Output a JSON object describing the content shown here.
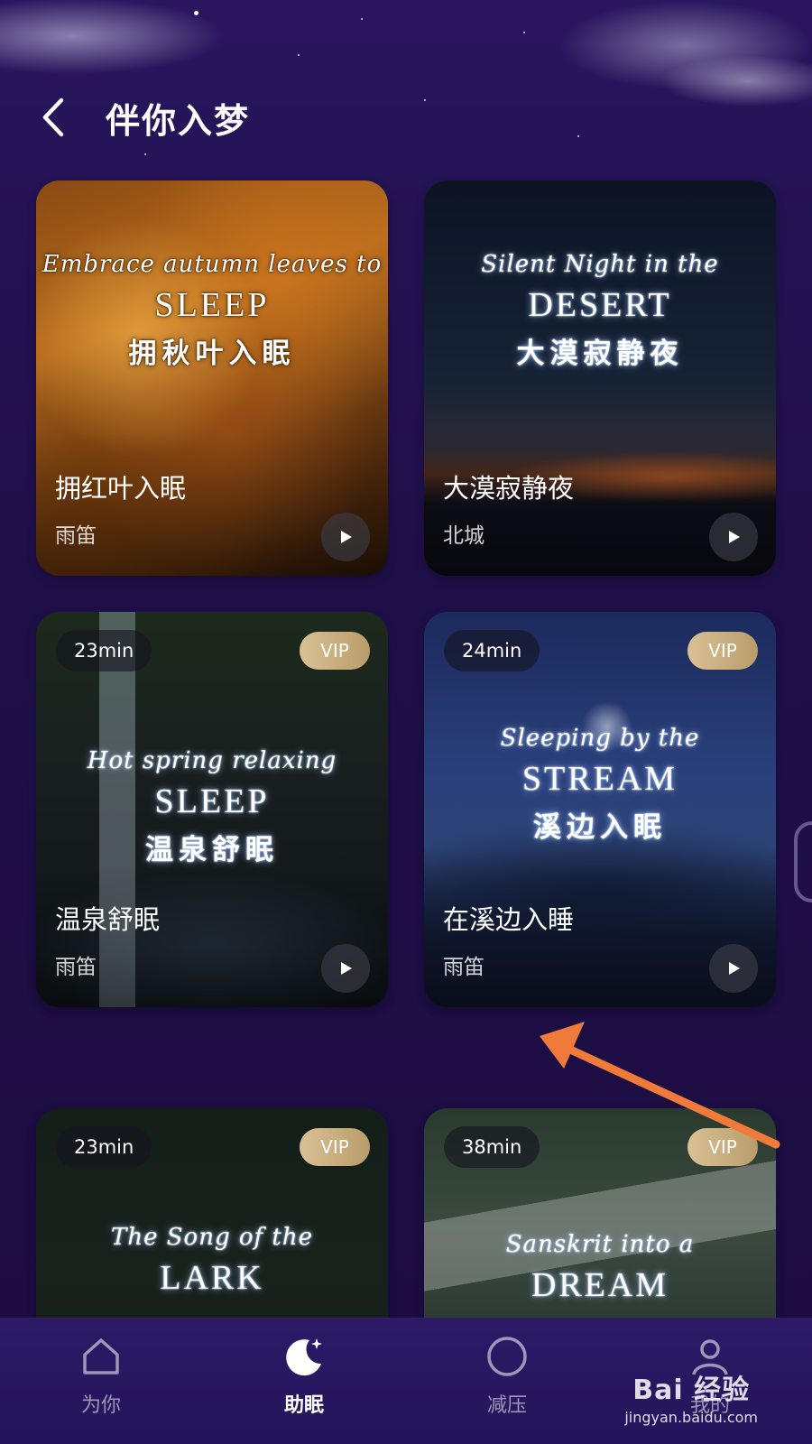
{
  "header": {
    "title": "伴你入梦"
  },
  "cards": [
    {
      "poster_script": "Embrace autumn leaves to",
      "poster_big": "SLEEP",
      "poster_cn": "拥秋叶入眠",
      "title": "拥红叶入眠",
      "author": "雨笛"
    },
    {
      "poster_script": "Silent Night in the",
      "poster_big": "DESERT",
      "poster_cn": "大漠寂静夜",
      "title": "大漠寂静夜",
      "author": "北城"
    },
    {
      "duration": "23min",
      "vip": "VIP",
      "poster_script": "Hot spring relaxing",
      "poster_big": "SLEEP",
      "poster_cn": "温泉舒眠",
      "title": "温泉舒眠",
      "author": "雨笛"
    },
    {
      "duration": "24min",
      "vip": "VIP",
      "poster_script": "Sleeping by the",
      "poster_big": "STREAM",
      "poster_cn": "溪边入眠",
      "title": "在溪边入睡",
      "author": "雨笛"
    },
    {
      "duration": "23min",
      "vip": "VIP",
      "poster_script": "The Song of the",
      "poster_big": "LARK"
    },
    {
      "duration": "38min",
      "vip": "VIP",
      "poster_script": "Sanskrit into a",
      "poster_big": "DREAM"
    }
  ],
  "tabs": [
    {
      "label": "为你",
      "icon": "home-icon"
    },
    {
      "label": "助眠",
      "icon": "moon-icon",
      "active": true
    },
    {
      "label": "减压",
      "icon": "circle-icon"
    },
    {
      "label": "我的",
      "icon": "profile-icon"
    }
  ],
  "watermark": {
    "brand": "Bai 经验",
    "url": "jingyan.baidu.com"
  },
  "colors": {
    "background": "#1e0f44",
    "tabbar": "#2c1a67",
    "vip_gold": "#c9ad7c",
    "annotation_arrow": "#f07a3a"
  }
}
